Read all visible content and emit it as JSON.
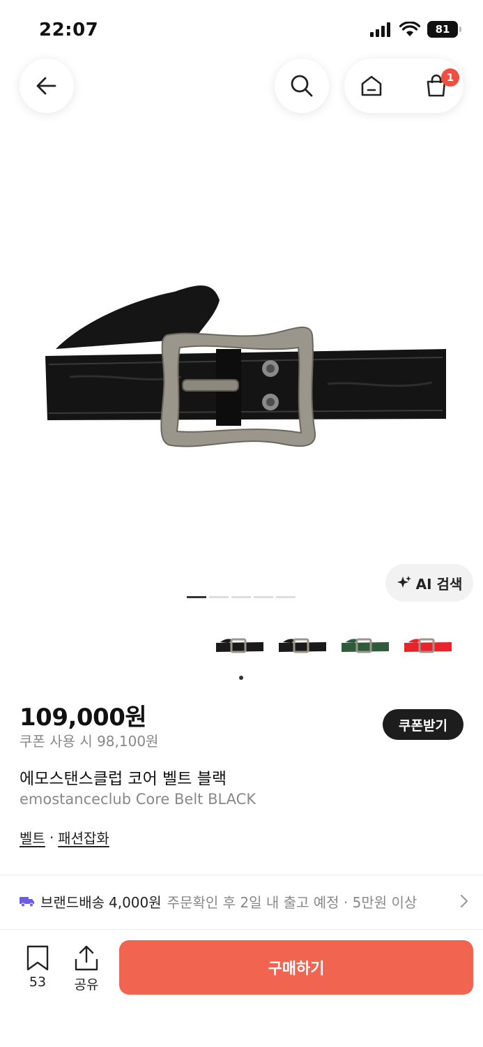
{
  "status_bar": {
    "time": "22:07",
    "battery": "81"
  },
  "header": {
    "cart_badge": "1"
  },
  "ai_search": {
    "label": "AI 검색"
  },
  "variants": [
    {
      "name": "black-1",
      "color": "#1a1a1a"
    },
    {
      "name": "black-2",
      "color": "#1a1a1a"
    },
    {
      "name": "green",
      "color": "#2f5b3a"
    },
    {
      "name": "red",
      "color": "#e8242b"
    }
  ],
  "product": {
    "price": "109,000원",
    "coupon_price": "쿠폰 사용 시 98,100원",
    "coupon_button": "쿠폰받기",
    "name_ko": "에모스탠스클럽 코어 벨트 블랙",
    "name_en": "emostanceclub Core Belt BLACK",
    "category": "벨트",
    "category_sep": "·",
    "subcategory": "패션잡화"
  },
  "shipping": {
    "label": "브랜드배송",
    "fee": "4,000원",
    "info": "주문확인 후 2일 내 출고 예정 · 5만원 이상"
  },
  "bottom_bar": {
    "wish_count": "53",
    "share_label": "공유",
    "buy_label": "구매하기"
  },
  "colors": {
    "accent": "#f06450",
    "badge": "#f04e3e",
    "shipping_icon": "#6c5ce7"
  }
}
